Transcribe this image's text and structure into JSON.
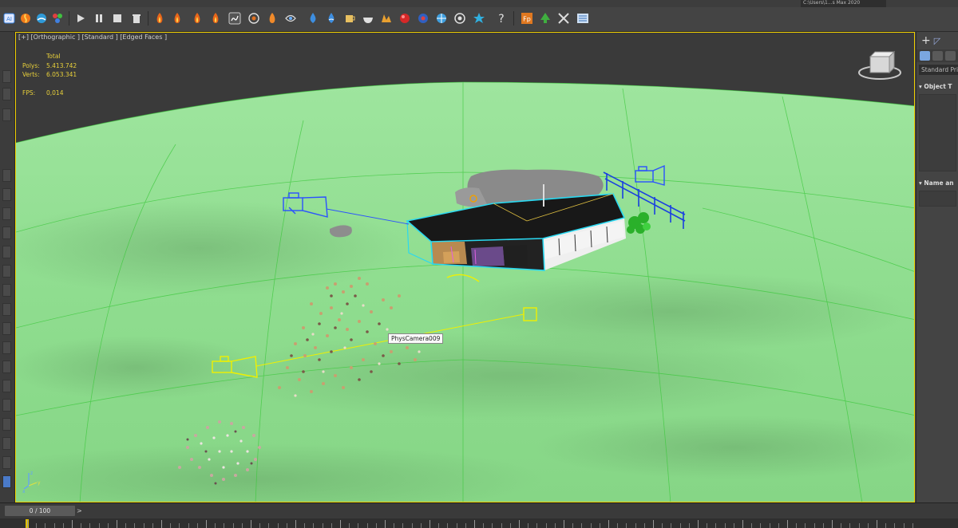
{
  "viewport": {
    "label": "[+] [Orthographic ] [Standard ] [Edged Faces ]",
    "stats": {
      "header": "Total",
      "polys_label": "Polys:",
      "polys_value": "5.413.742",
      "verts_label": "Verts:",
      "verts_value": "6.053.341",
      "fps_label": "FPS:",
      "fps_value": "0,014"
    },
    "camera_tag": "PhysCamera009",
    "colors": {
      "ground": "#8fe08f",
      "selection": "#f0d000",
      "camera_blue": "#2a50ff",
      "camera_yellow": "#f0f000"
    }
  },
  "command_panel": {
    "dropdown": "Standard Pri",
    "rollout_object_type": "Object T",
    "rollout_name": "Name an"
  },
  "toolbar": {
    "path_field": "C:\\Users\\1...s Max 2020"
  },
  "timeline": {
    "slider": "0 / 100",
    "next": ">"
  }
}
